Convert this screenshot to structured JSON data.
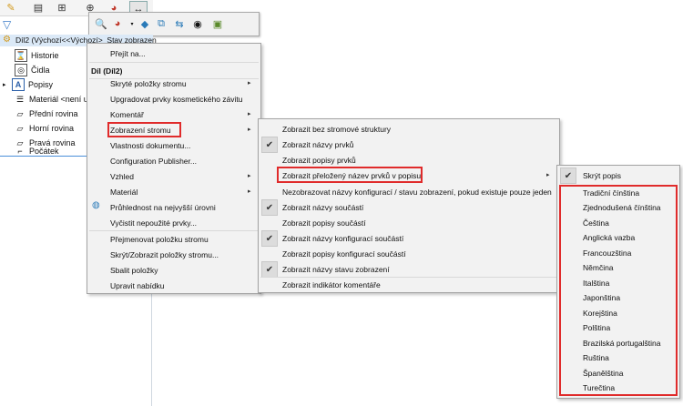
{
  "tree": {
    "root_label": "Díl2  (Výchozí<<Výchozí>_Stav zobrazen",
    "items": [
      {
        "label": "Historie",
        "icon": "history-icon"
      },
      {
        "label": "Čidla",
        "icon": "sensor-icon"
      },
      {
        "label": "Popisy",
        "icon": "annotation-icon"
      },
      {
        "label": "Materiál <není ur",
        "icon": "material-icon"
      },
      {
        "label": "Přední rovina",
        "icon": "plane-icon"
      },
      {
        "label": "Horní rovina",
        "icon": "plane-icon"
      },
      {
        "label": "Pravá rovina",
        "icon": "plane-icon"
      },
      {
        "label": "Počátek",
        "icon": "origin-icon"
      }
    ]
  },
  "context_menu": {
    "goto": "Přejít na...",
    "header": "Díl (Díl2)",
    "items": [
      {
        "label": "Skryté položky stromu",
        "submenu": true
      },
      {
        "label": "Upgradovat prvky kosmetického závitu",
        "submenu": false
      },
      {
        "label": "Komentář",
        "submenu": true
      },
      {
        "label": "Zobrazení stromu",
        "submenu": true
      },
      {
        "label": "Vlastnosti dokumentu...",
        "submenu": false
      },
      {
        "label": "Configuration Publisher...",
        "submenu": false
      },
      {
        "label": "Vzhled",
        "submenu": true
      },
      {
        "label": "Materiál",
        "submenu": true
      },
      {
        "label": "Průhlednost na nejvyšší úrovni",
        "submenu": false
      },
      {
        "label": "Vyčistit nepoužité prvky...",
        "submenu": false
      },
      {
        "label": "Přejmenovat položku stromu",
        "submenu": false
      },
      {
        "label": "Skrýt/Zobrazit položky stromu...",
        "submenu": false
      },
      {
        "label": "Sbalit položky",
        "submenu": false
      },
      {
        "label": "Upravit nabídku",
        "submenu": false
      }
    ]
  },
  "tree_display_menu": {
    "items": [
      {
        "label": "Zobrazit bez stromové struktury",
        "checked": false
      },
      {
        "label": "Zobrazit názvy prvků",
        "checked": true
      },
      {
        "label": "Zobrazit popisy prvků",
        "checked": false
      },
      {
        "label": "Zobrazit přeložený název prvků v popisu",
        "checked": false,
        "submenu": true
      },
      {
        "label": "Nezobrazovat názvy konfigurací / stavu zobrazení,  pokud existuje pouze jeden",
        "checked": false
      },
      {
        "label": "Zobrazit názvy součástí",
        "checked": true
      },
      {
        "label": "Zobrazit popisy součástí",
        "checked": false
      },
      {
        "label": "Zobrazit názvy konfigurací součástí",
        "checked": true
      },
      {
        "label": "Zobrazit popisy konfigurací součástí",
        "checked": false
      },
      {
        "label": "Zobrazit názvy stavu zobrazení",
        "checked": true
      },
      {
        "label": "Zobrazit indikátor komentáře",
        "checked": false
      }
    ]
  },
  "language_menu": {
    "hide_label": "Skrýt popis",
    "languages": [
      "Tradiční čínština",
      "Zjednodušená čínština",
      "Čeština",
      "Anglická vazba",
      "Francouzština",
      "Němčina",
      "Italština",
      "Japonština",
      "Korejština",
      "Polština",
      "Brazilská portugalština",
      "Ruština",
      "Španělština",
      "Turečtina"
    ]
  },
  "colors": {
    "highlight_red": "#e02b2b",
    "menu_bg": "#f2f2f2",
    "tree_selection": "#dbe9f7"
  }
}
